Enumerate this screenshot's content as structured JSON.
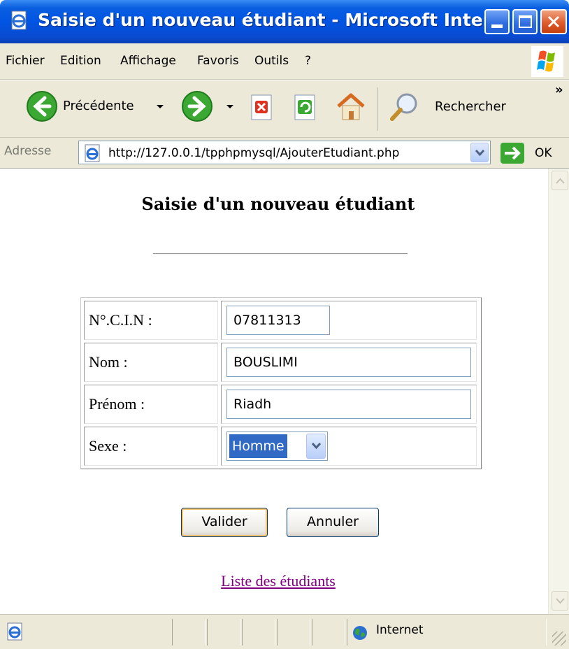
{
  "window": {
    "title": "Saisie d'un nouveau étudiant - Microsoft Intern..."
  },
  "menubar": {
    "items": [
      "Fichier",
      "Edition",
      "Affichage",
      "Favoris",
      "Outils",
      "?"
    ]
  },
  "toolbar": {
    "back_label": "Précédente",
    "search_label": "Rechercher",
    "more": "»"
  },
  "addressbar": {
    "label": "Adresse",
    "url": "http://127.0.0.1/tpphpmysql/AjouterEtudiant.php",
    "go_label": "OK"
  },
  "page": {
    "heading": "Saisie d'un nouveau étudiant",
    "form": {
      "cin_label": "N°.C.I.N :",
      "cin_value": "07811313",
      "nom_label": "Nom :",
      "nom_value": "BOUSLIMI",
      "prenom_label": "Prénom :",
      "prenom_value": "Riadh",
      "sexe_label": "Sexe :",
      "sexe_value": "Homme"
    },
    "buttons": {
      "submit": "Valider",
      "reset": "Annuler"
    },
    "link": "Liste des étudiants"
  },
  "statusbar": {
    "zone": "Internet"
  },
  "colors": {
    "titlebar": "#0054e3",
    "chrome": "#ece9d8",
    "selection": "#316ac5",
    "visited_link": "#800080"
  }
}
